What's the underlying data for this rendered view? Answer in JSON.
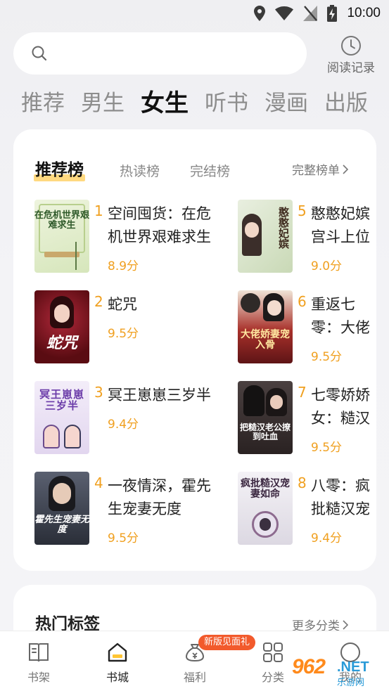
{
  "status_bar": {
    "time": "10:00"
  },
  "header": {
    "history_label": "阅读记录"
  },
  "channels": [
    {
      "label": "推荐",
      "active": false
    },
    {
      "label": "男生",
      "active": false
    },
    {
      "label": "女生",
      "active": true
    },
    {
      "label": "听书",
      "active": false
    },
    {
      "label": "漫画",
      "active": false
    },
    {
      "label": "出版",
      "active": false
    }
  ],
  "ranking": {
    "tabs": [
      "推荐榜",
      "热读榜",
      "完结榜"
    ],
    "active_tab": "推荐榜",
    "full_list_label": "完整榜单",
    "books": [
      {
        "rank": "1",
        "title": "空间囤货：在危机世界艰难求生",
        "score": "8.9分",
        "cover_text": "在危机世界艰难求生",
        "cover_color": "#e6efd2"
      },
      {
        "rank": "2",
        "title": "蛇咒",
        "score": "9.5分",
        "cover_text": "蛇咒",
        "cover_color": "#7a1418"
      },
      {
        "rank": "3",
        "title": "冥王崽崽三岁半",
        "score": "9.4分",
        "cover_text": "冥王崽崽三岁半",
        "cover_color": "#ece4f4"
      },
      {
        "rank": "4",
        "title": "一夜情深，霍先生宠妻无度",
        "score": "9.5分",
        "cover_text": "霍先生宠妻无度",
        "cover_color": "#3a3f4a"
      },
      {
        "rank": "5",
        "title": "憨憨妃嫔宫斗上位记",
        "score": "9.0分",
        "cover_text": "憨憨妃嫔",
        "cover_color": "#dfe8d4"
      },
      {
        "rank": "6",
        "title": "重返七零：大佬娇妻宠入骨",
        "score": "9.5分",
        "cover_text": "大佬娇妻宠入骨",
        "cover_color": "#6b1a1c"
      },
      {
        "rank": "7",
        "title": "七零娇娇女：糙汉老公撩到吐血",
        "score": "9.5分",
        "cover_text": "把糙汉老公撩到吐血",
        "cover_color": "#3b3130"
      },
      {
        "rank": "8",
        "title": "八零：疯批糙汉宠妻如命",
        "score": "9.4分",
        "cover_text": "疯批糙汉宠妻如命",
        "cover_color": "#eceaf0"
      }
    ]
  },
  "tags_section": {
    "title": "热门标签",
    "more_label": "更多分类"
  },
  "bottom_nav": {
    "items": [
      {
        "label": "书架",
        "icon": "bookshelf-icon"
      },
      {
        "label": "书城",
        "icon": "bookstore-icon",
        "active": true
      },
      {
        "label": "福利",
        "icon": "money-bag-icon"
      },
      {
        "label": "分类",
        "icon": "category-icon"
      },
      {
        "label": "我的",
        "icon": "profile-icon"
      }
    ],
    "welfare_badge": "新版见面礼"
  },
  "watermark": {
    "number": "962",
    "net": ".NET",
    "sub": "乐游网"
  }
}
